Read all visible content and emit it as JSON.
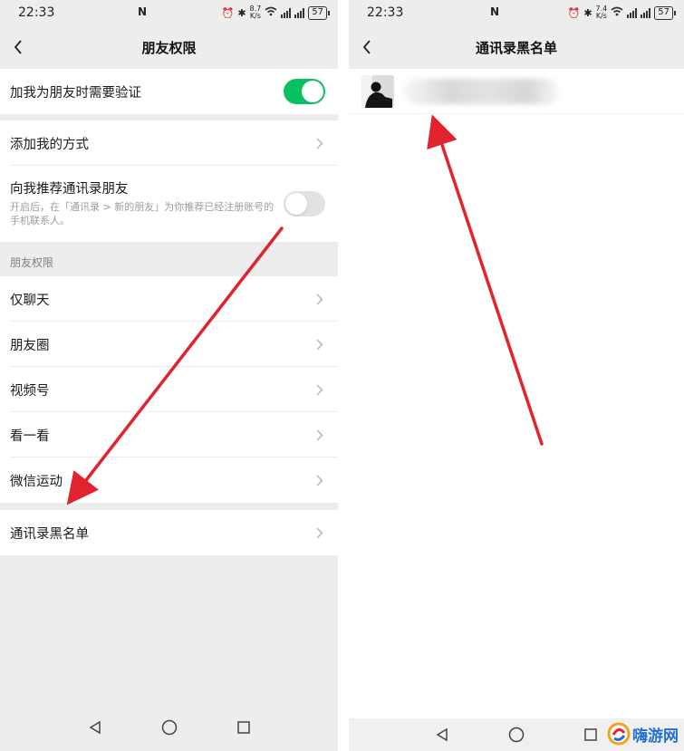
{
  "status_bar": {
    "time": "22:33",
    "battery": "57",
    "speed_left": "8.7",
    "speed_right": "7.4",
    "speed_unit": "K/s"
  },
  "left_screen": {
    "title": "朋友权限",
    "verify_row": {
      "label": "加我为朋友时需要验证",
      "toggle": "on"
    },
    "add_method_label": "添加我的方式",
    "recommend_row": {
      "label": "向我推荐通讯录朋友",
      "description": "开启后，在「通讯录 > 新的朋友」为你推荐已经注册账号的手机联系人。",
      "toggle": "off"
    },
    "section_header": "朋友权限",
    "permission_items": [
      {
        "label": "仅聊天"
      },
      {
        "label": "朋友圈"
      },
      {
        "label": "视频号"
      },
      {
        "label": "看一看"
      },
      {
        "label": "微信运动"
      }
    ],
    "blacklist_label": "通讯录黑名单"
  },
  "right_screen": {
    "title": "通讯录黑名单",
    "contacts": [
      {
        "avatar": "person-silhouette-photo",
        "name_blurred": true
      }
    ]
  },
  "watermark": {
    "text": "嗨游网"
  },
  "colors": {
    "toggle_on": "#07c160",
    "toggle_off": "#e2e2e2",
    "background": "#ededed",
    "arrow": "#e0232f",
    "watermark": "#1f6fd6"
  }
}
